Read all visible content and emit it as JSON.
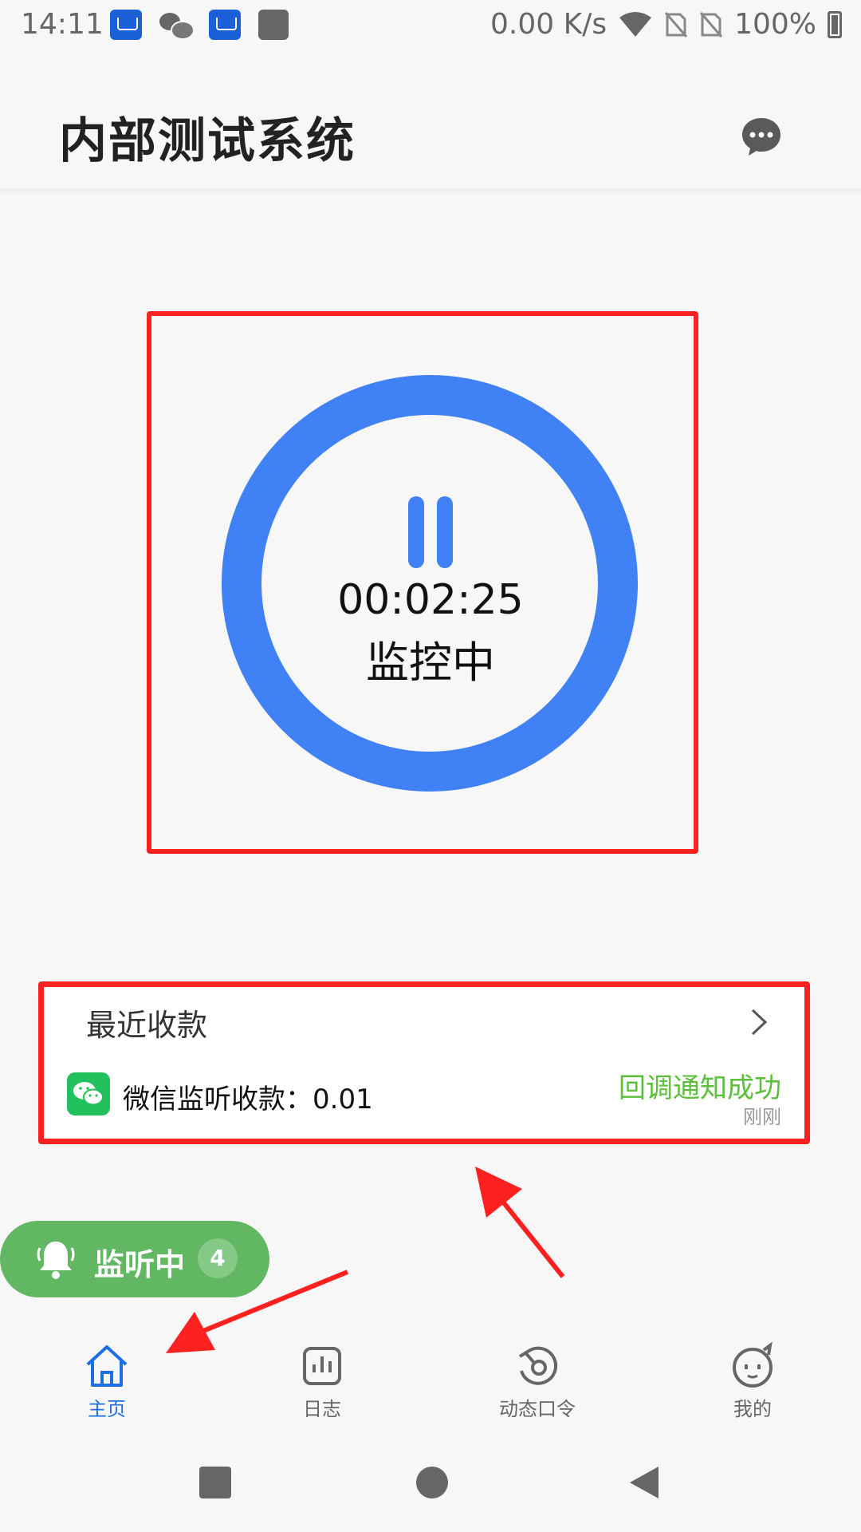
{
  "status_bar": {
    "time": "14:11",
    "net_speed": "0.00 K/s",
    "battery": "100%",
    "icons": [
      "app-notification-icon",
      "wechat-icon",
      "app-notification-icon",
      "app-square-icon",
      "wifi-icon",
      "no-sim-icon",
      "no-sim-icon",
      "battery-charging-icon"
    ]
  },
  "header": {
    "title": "内部测试系统",
    "action_icon": "chat-bubble-icon"
  },
  "monitor": {
    "elapsed": "00:02:25",
    "status": "监控中",
    "control_icon": "pause-icon",
    "ring_color": "#4081f5"
  },
  "recent": {
    "title": "最近收款",
    "items": [
      {
        "source_icon": "wechat-pay-icon",
        "text": "微信监听收款：0.01",
        "status": "回调通知成功",
        "time": "刚刚"
      }
    ]
  },
  "listening": {
    "label": "监听中",
    "count": "4",
    "color": "#62b763"
  },
  "nav": {
    "items": [
      {
        "label": "主页",
        "icon": "home-icon",
        "active": true
      },
      {
        "label": "日志",
        "icon": "bar-chart-icon",
        "active": false
      },
      {
        "label": "动态口令",
        "icon": "dynamic-password-icon",
        "active": false
      },
      {
        "label": "我的",
        "icon": "profile-face-icon",
        "active": false
      }
    ],
    "active_color": "#1e6fe0"
  },
  "annotation_color": "#ff2020"
}
